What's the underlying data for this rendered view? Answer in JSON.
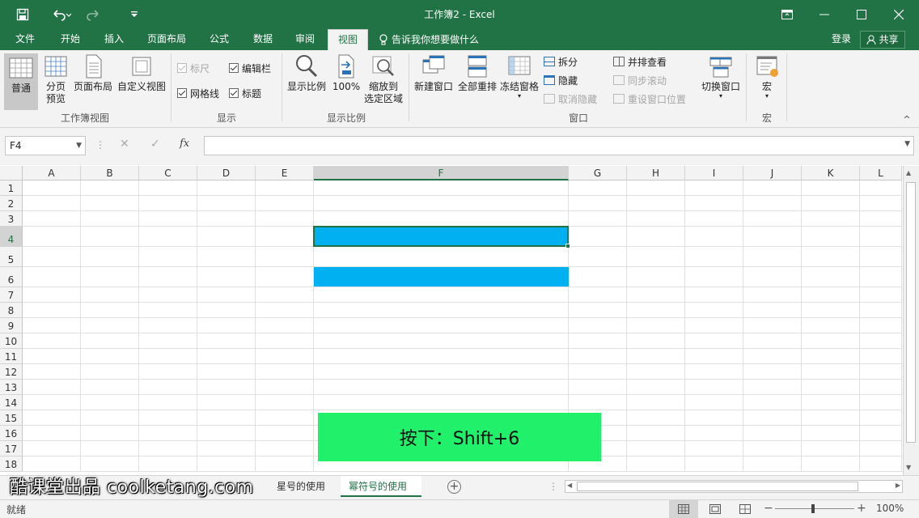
{
  "window": {
    "title": "工作簿2 - Excel"
  },
  "tabs": [
    "文件",
    "开始",
    "插入",
    "页面布局",
    "公式",
    "数据",
    "审阅",
    "视图"
  ],
  "tell_me": "告诉我你想要做什么",
  "account": {
    "login": "登录",
    "share": "共享"
  },
  "ribbon": {
    "workbook_views": {
      "label": "工作簿视图",
      "normal": "普通",
      "page_break_1": "分页",
      "page_break_2": "预览",
      "page_layout": "页面布局",
      "custom_views": "自定义视图"
    },
    "show": {
      "label": "显示",
      "ruler": "标尺",
      "formula_bar": "编辑栏",
      "gridlines": "网格线",
      "headings": "标题"
    },
    "zoom": {
      "label": "显示比例",
      "zoom": "显示比例",
      "zoom100": "100%",
      "zoom_sel_1": "缩放到",
      "zoom_sel_2": "选定区域"
    },
    "window": {
      "label": "窗口",
      "new_window": "新建窗口",
      "arrange_all": "全部重排",
      "freeze": "冻结窗格",
      "split": "拆分",
      "hide": "隐藏",
      "unhide": "取消隐藏",
      "side_by_side": "并排查看",
      "sync_scroll": "同步滚动",
      "reset_pos": "重设窗口位置",
      "switch": "切换窗口"
    },
    "macros": {
      "label": "宏",
      "macros": "宏"
    }
  },
  "formula_bar": {
    "name_box": "F4",
    "fx": "fx"
  },
  "columns": [
    "A",
    "B",
    "C",
    "D",
    "E",
    "F",
    "G",
    "H",
    "I",
    "J",
    "K",
    "L"
  ],
  "rows": [
    "1",
    "2",
    "3",
    "4",
    "5",
    "6",
    "7",
    "8",
    "9",
    "10",
    "11",
    "12",
    "13",
    "14",
    "15",
    "16",
    "17",
    "18"
  ],
  "selected_column": "F",
  "selected_row": "4",
  "callout": "按下：Shift+6",
  "sheets": [
    "星号的使用",
    "幂符号的使用"
  ],
  "active_sheet": "幂符号的使用",
  "watermark": "酷课堂出品 coolketang.com",
  "status": {
    "ready": "就绪",
    "zoom": "100%"
  },
  "colors": {
    "brand": "#217346",
    "fill": "#00b0f0",
    "callout": "#20f06a"
  }
}
